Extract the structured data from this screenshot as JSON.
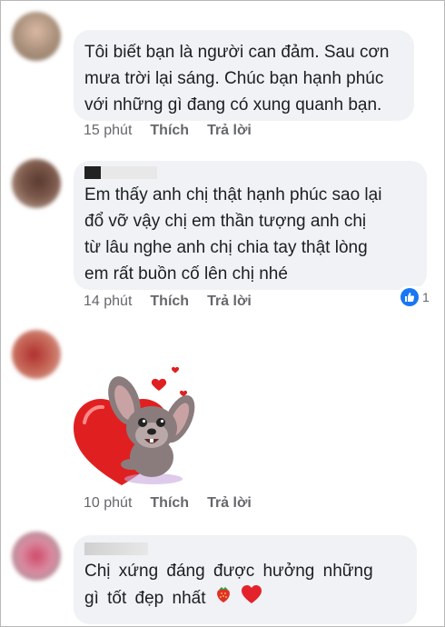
{
  "comments": [
    {
      "text_lines": [
        "Tôi biết bạn là người can đảm. Sau cơn",
        "mưa trời lại sáng. Chúc bạn hạnh phúc",
        "với những gì đang có xung quanh bạn."
      ],
      "time": "15 phút",
      "like_label": "Thích",
      "reply_label": "Trả lời"
    },
    {
      "text_lines": [
        "Em thấy anh chị thật hạnh phúc sao lại",
        "đổ vỡ vậy chị em thần tượng anh chị",
        "từ lâu nghe anh chị chia tay thật lòng",
        "em rất buồn cố lên chị nhé"
      ],
      "time": "14 phút",
      "like_label": "Thích",
      "reply_label": "Trả lời",
      "reaction_icon": "thumbs-up-icon",
      "reaction_count": "1"
    },
    {
      "sticker": "dog-with-heart-sticker",
      "time": "10 phút",
      "like_label": "Thích",
      "reply_label": "Trả lời"
    },
    {
      "text_lines": [
        "Chị xứng đáng được hưởng những",
        "gì tốt đẹp nhất"
      ],
      "emojis": [
        "strawberry-icon",
        "red-heart-icon"
      ]
    }
  ],
  "colors": {
    "bubble": "#f0f2f5",
    "meta_text": "#65676b",
    "like_blue": "#1877f2"
  }
}
